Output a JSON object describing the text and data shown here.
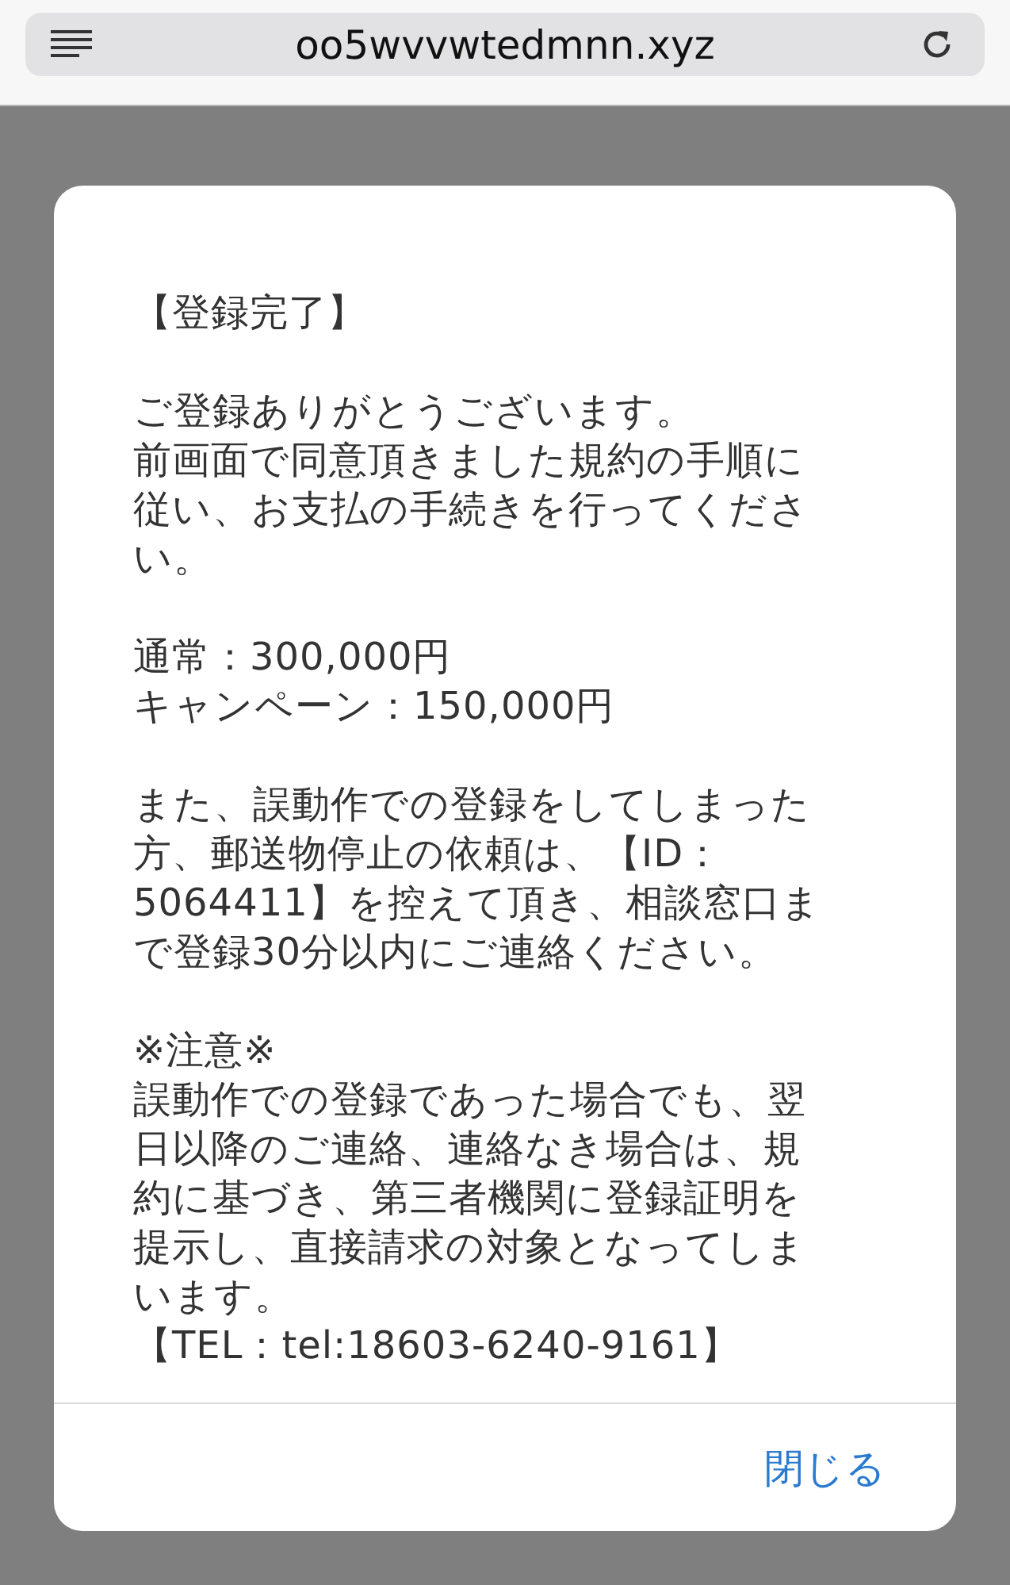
{
  "browser": {
    "url": "oo5wvvwtedmnn.xyz"
  },
  "dialog": {
    "paragraphs": [
      [
        "【登録完了】"
      ],
      [
        "ご登録ありがとうございます。",
        "前画面で同意頂きました規約の手順に",
        "従い、お支払の手続きを行ってくださ",
        "い。"
      ],
      [
        "通常：300,000円",
        "キャンペーン：150,000円"
      ],
      [
        "また、誤動作での登録をしてしまった",
        "方、郵送物停止の依頼は、【ID：",
        "5064411】を控えて頂き、相談窓口ま",
        "で登録30分以内にご連絡ください。"
      ],
      [
        "※注意※",
        "誤動作での登録であった場合でも、翌",
        "日以降のご連絡、連絡なき場合は、規",
        "約に基づき、第三者機関に登録証明を",
        "提示し、直接請求の対象となってしま",
        "います。",
        "【TEL：tel:18603-6240-9161】"
      ]
    ],
    "button": "閉じる"
  }
}
